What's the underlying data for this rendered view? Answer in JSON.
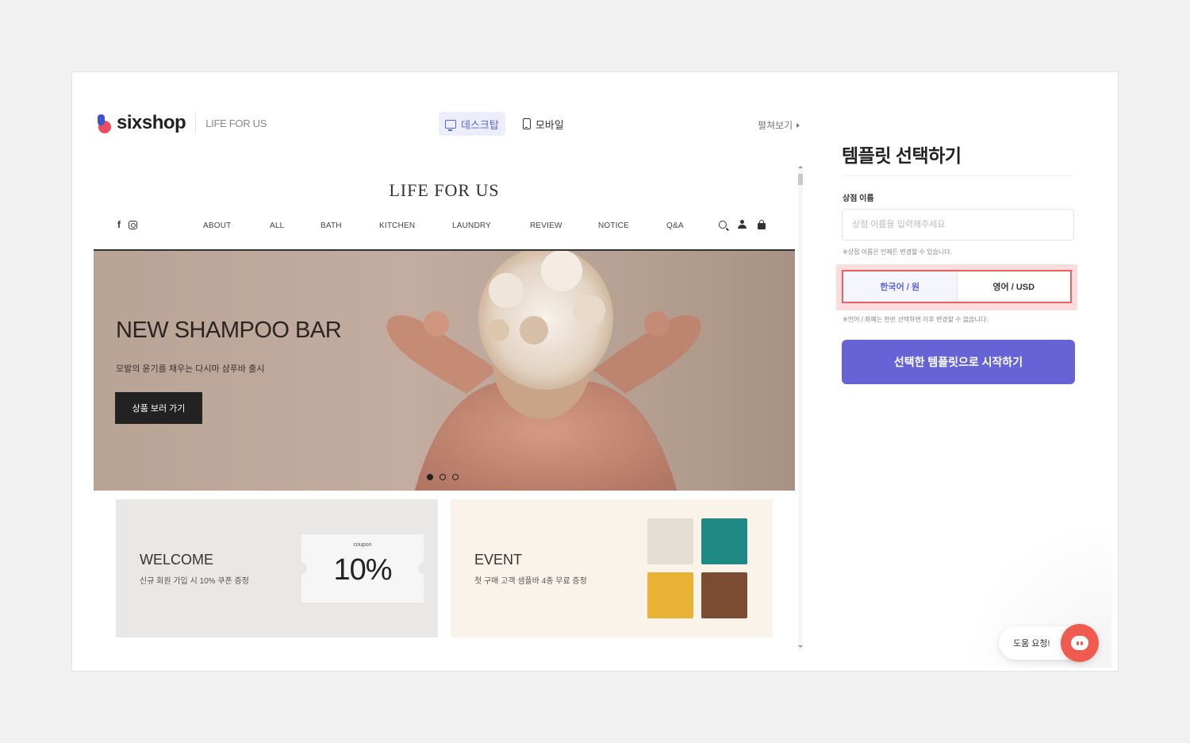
{
  "header": {
    "brand": "sixshop",
    "store_name": "LIFE FOR US",
    "view_desktop": "데스크탑",
    "view_mobile": "모바일",
    "expand": "펼쳐보기"
  },
  "preview": {
    "site_title": "LIFE FOR US",
    "menu": [
      "ABOUT",
      "ALL",
      "BATH",
      "KITCHEN",
      "LAUNDRY",
      "REVIEW",
      "NOTICE",
      "Q&A"
    ],
    "hero": {
      "heading": "NEW SHAMPOO BAR",
      "subtitle": "모발의 윤기를 채우는 다시마 샴푸바 출시",
      "button": "상품 보러 가기",
      "slide_count": 3,
      "active_slide": 1
    },
    "welcome_card": {
      "title": "WELCOME",
      "subtitle": "신규 회원 가입 시 10% 쿠폰 증정",
      "coupon_label": "coupon",
      "coupon_value": "10%"
    },
    "event_card": {
      "title": "EVENT",
      "subtitle": "첫 구매 고객 샘플바 4종 무료 증정",
      "swatches": [
        "#e2ddd5",
        "#1f8a83",
        "#e8b235",
        "#7b4c32"
      ]
    }
  },
  "panel": {
    "title": "템플릿 선택하기",
    "store_name_label": "상점 이름",
    "store_name_placeholder": "상점 이름을 입력해주세요",
    "store_name_value": "",
    "store_name_hint": "※상점 이름은 언제든 변경할 수 있습니다.",
    "lang_options": [
      "한국어 / 원",
      "영어 / USD"
    ],
    "lang_selected": "한국어 / 원",
    "lang_hint": "※언어 / 화폐는 한번 선택하면 이후 변경할 수 없습니다.",
    "start_button": "선택한 템플릿으로 시작하기"
  },
  "help": {
    "label": "도움 요청!"
  },
  "colors": {
    "accent": "#6563d6",
    "accent_light": "#eceefc",
    "highlight_border": "#e86262",
    "highlight_fill": "#fbdcdc",
    "help_button": "#ef5b4f"
  }
}
